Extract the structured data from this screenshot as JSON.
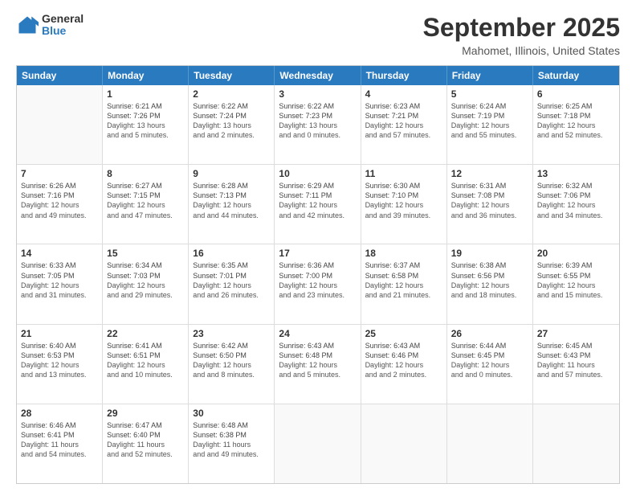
{
  "header": {
    "logo_general": "General",
    "logo_blue": "Blue",
    "month_title": "September 2025",
    "location": "Mahomet, Illinois, United States"
  },
  "weekdays": [
    "Sunday",
    "Monday",
    "Tuesday",
    "Wednesday",
    "Thursday",
    "Friday",
    "Saturday"
  ],
  "rows": [
    [
      {
        "day": "",
        "sunrise": "",
        "sunset": "",
        "daylight": ""
      },
      {
        "day": "1",
        "sunrise": "Sunrise: 6:21 AM",
        "sunset": "Sunset: 7:26 PM",
        "daylight": "Daylight: 13 hours and 5 minutes."
      },
      {
        "day": "2",
        "sunrise": "Sunrise: 6:22 AM",
        "sunset": "Sunset: 7:24 PM",
        "daylight": "Daylight: 13 hours and 2 minutes."
      },
      {
        "day": "3",
        "sunrise": "Sunrise: 6:22 AM",
        "sunset": "Sunset: 7:23 PM",
        "daylight": "Daylight: 13 hours and 0 minutes."
      },
      {
        "day": "4",
        "sunrise": "Sunrise: 6:23 AM",
        "sunset": "Sunset: 7:21 PM",
        "daylight": "Daylight: 12 hours and 57 minutes."
      },
      {
        "day": "5",
        "sunrise": "Sunrise: 6:24 AM",
        "sunset": "Sunset: 7:19 PM",
        "daylight": "Daylight: 12 hours and 55 minutes."
      },
      {
        "day": "6",
        "sunrise": "Sunrise: 6:25 AM",
        "sunset": "Sunset: 7:18 PM",
        "daylight": "Daylight: 12 hours and 52 minutes."
      }
    ],
    [
      {
        "day": "7",
        "sunrise": "Sunrise: 6:26 AM",
        "sunset": "Sunset: 7:16 PM",
        "daylight": "Daylight: 12 hours and 49 minutes."
      },
      {
        "day": "8",
        "sunrise": "Sunrise: 6:27 AM",
        "sunset": "Sunset: 7:15 PM",
        "daylight": "Daylight: 12 hours and 47 minutes."
      },
      {
        "day": "9",
        "sunrise": "Sunrise: 6:28 AM",
        "sunset": "Sunset: 7:13 PM",
        "daylight": "Daylight: 12 hours and 44 minutes."
      },
      {
        "day": "10",
        "sunrise": "Sunrise: 6:29 AM",
        "sunset": "Sunset: 7:11 PM",
        "daylight": "Daylight: 12 hours and 42 minutes."
      },
      {
        "day": "11",
        "sunrise": "Sunrise: 6:30 AM",
        "sunset": "Sunset: 7:10 PM",
        "daylight": "Daylight: 12 hours and 39 minutes."
      },
      {
        "day": "12",
        "sunrise": "Sunrise: 6:31 AM",
        "sunset": "Sunset: 7:08 PM",
        "daylight": "Daylight: 12 hours and 36 minutes."
      },
      {
        "day": "13",
        "sunrise": "Sunrise: 6:32 AM",
        "sunset": "Sunset: 7:06 PM",
        "daylight": "Daylight: 12 hours and 34 minutes."
      }
    ],
    [
      {
        "day": "14",
        "sunrise": "Sunrise: 6:33 AM",
        "sunset": "Sunset: 7:05 PM",
        "daylight": "Daylight: 12 hours and 31 minutes."
      },
      {
        "day": "15",
        "sunrise": "Sunrise: 6:34 AM",
        "sunset": "Sunset: 7:03 PM",
        "daylight": "Daylight: 12 hours and 29 minutes."
      },
      {
        "day": "16",
        "sunrise": "Sunrise: 6:35 AM",
        "sunset": "Sunset: 7:01 PM",
        "daylight": "Daylight: 12 hours and 26 minutes."
      },
      {
        "day": "17",
        "sunrise": "Sunrise: 6:36 AM",
        "sunset": "Sunset: 7:00 PM",
        "daylight": "Daylight: 12 hours and 23 minutes."
      },
      {
        "day": "18",
        "sunrise": "Sunrise: 6:37 AM",
        "sunset": "Sunset: 6:58 PM",
        "daylight": "Daylight: 12 hours and 21 minutes."
      },
      {
        "day": "19",
        "sunrise": "Sunrise: 6:38 AM",
        "sunset": "Sunset: 6:56 PM",
        "daylight": "Daylight: 12 hours and 18 minutes."
      },
      {
        "day": "20",
        "sunrise": "Sunrise: 6:39 AM",
        "sunset": "Sunset: 6:55 PM",
        "daylight": "Daylight: 12 hours and 15 minutes."
      }
    ],
    [
      {
        "day": "21",
        "sunrise": "Sunrise: 6:40 AM",
        "sunset": "Sunset: 6:53 PM",
        "daylight": "Daylight: 12 hours and 13 minutes."
      },
      {
        "day": "22",
        "sunrise": "Sunrise: 6:41 AM",
        "sunset": "Sunset: 6:51 PM",
        "daylight": "Daylight: 12 hours and 10 minutes."
      },
      {
        "day": "23",
        "sunrise": "Sunrise: 6:42 AM",
        "sunset": "Sunset: 6:50 PM",
        "daylight": "Daylight: 12 hours and 8 minutes."
      },
      {
        "day": "24",
        "sunrise": "Sunrise: 6:43 AM",
        "sunset": "Sunset: 6:48 PM",
        "daylight": "Daylight: 12 hours and 5 minutes."
      },
      {
        "day": "25",
        "sunrise": "Sunrise: 6:43 AM",
        "sunset": "Sunset: 6:46 PM",
        "daylight": "Daylight: 12 hours and 2 minutes."
      },
      {
        "day": "26",
        "sunrise": "Sunrise: 6:44 AM",
        "sunset": "Sunset: 6:45 PM",
        "daylight": "Daylight: 12 hours and 0 minutes."
      },
      {
        "day": "27",
        "sunrise": "Sunrise: 6:45 AM",
        "sunset": "Sunset: 6:43 PM",
        "daylight": "Daylight: 11 hours and 57 minutes."
      }
    ],
    [
      {
        "day": "28",
        "sunrise": "Sunrise: 6:46 AM",
        "sunset": "Sunset: 6:41 PM",
        "daylight": "Daylight: 11 hours and 54 minutes."
      },
      {
        "day": "29",
        "sunrise": "Sunrise: 6:47 AM",
        "sunset": "Sunset: 6:40 PM",
        "daylight": "Daylight: 11 hours and 52 minutes."
      },
      {
        "day": "30",
        "sunrise": "Sunrise: 6:48 AM",
        "sunset": "Sunset: 6:38 PM",
        "daylight": "Daylight: 11 hours and 49 minutes."
      },
      {
        "day": "",
        "sunrise": "",
        "sunset": "",
        "daylight": ""
      },
      {
        "day": "",
        "sunrise": "",
        "sunset": "",
        "daylight": ""
      },
      {
        "day": "",
        "sunrise": "",
        "sunset": "",
        "daylight": ""
      },
      {
        "day": "",
        "sunrise": "",
        "sunset": "",
        "daylight": ""
      }
    ]
  ]
}
